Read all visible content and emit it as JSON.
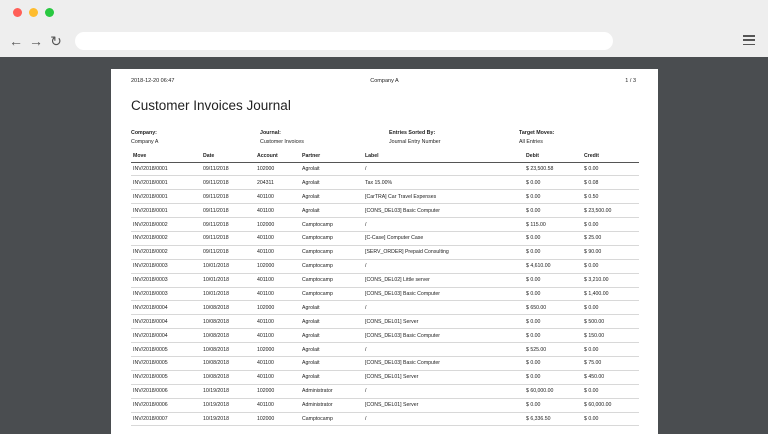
{
  "report": {
    "printed_at": "2018-12-20 06:47",
    "company_header": "Company A",
    "page": "1   /   3",
    "title": "Customer Invoices Journal",
    "info": [
      {
        "label": "Company:",
        "value": "Company A"
      },
      {
        "label": "Journal:",
        "value": "Customer Invoices"
      },
      {
        "label": "Entries Sorted By:",
        "value": "Journal Entry Number"
      },
      {
        "label": "Target Moves:",
        "value": "All Entries"
      }
    ],
    "columns": [
      "Move",
      "Date",
      "Account",
      "Partner",
      "Label",
      "Debit",
      "Credit"
    ],
    "rows": [
      [
        "INV/2018/0001",
        "09/11/2018",
        "102000",
        "Agrolait",
        "/",
        "$ 23,500.58",
        "$ 0.00"
      ],
      [
        "INV/2018/0001",
        "09/11/2018",
        "204311",
        "Agrolait",
        "Tax 15.00%",
        "$ 0.00",
        "$ 0.08"
      ],
      [
        "INV/2018/0001",
        "09/11/2018",
        "401100",
        "Agrolait",
        "[CarTRA] Car Travel Expenses",
        "$ 0.00",
        "$ 0.50"
      ],
      [
        "INV/2018/0001",
        "09/11/2018",
        "401100",
        "Agrolait",
        "[CONS_DEL03] Basic Computer",
        "$ 0.00",
        "$ 23,500.00"
      ],
      [
        "INV/2018/0002",
        "09/11/2018",
        "102000",
        "Camptocamp",
        "/",
        "$ 115.00",
        "$ 0.00"
      ],
      [
        "INV/2018/0002",
        "09/11/2018",
        "401100",
        "Camptocamp",
        "[C-Case] Computer Case",
        "$ 0.00",
        "$ 25.00"
      ],
      [
        "INV/2018/0002",
        "09/11/2018",
        "401100",
        "Camptocamp",
        "[SERV_ORDER] Prepaid Consulting",
        "$ 0.00",
        "$ 90.00"
      ],
      [
        "INV/2018/0003",
        "10/01/2018",
        "102000",
        "Camptocamp",
        "/",
        "$ 4,610.00",
        "$ 0.00"
      ],
      [
        "INV/2018/0003",
        "10/01/2018",
        "401100",
        "Camptocamp",
        "[CONS_DEL02] Little server",
        "$ 0.00",
        "$ 3,210.00"
      ],
      [
        "INV/2018/0003",
        "10/01/2018",
        "401100",
        "Camptocamp",
        "[CONS_DEL03] Basic Computer",
        "$ 0.00",
        "$ 1,400.00"
      ],
      [
        "INV/2018/0004",
        "10/08/2018",
        "102000",
        "Agrolait",
        "/",
        "$ 650.00",
        "$ 0.00"
      ],
      [
        "INV/2018/0004",
        "10/08/2018",
        "401100",
        "Agrolait",
        "[CONS_DEL01] Server",
        "$ 0.00",
        "$ 500.00"
      ],
      [
        "INV/2018/0004",
        "10/08/2018",
        "401100",
        "Agrolait",
        "[CONS_DEL03] Basic Computer",
        "$ 0.00",
        "$ 150.00"
      ],
      [
        "INV/2018/0005",
        "10/08/2018",
        "102000",
        "Agrolait",
        "/",
        "$ 525.00",
        "$ 0.00"
      ],
      [
        "INV/2018/0005",
        "10/08/2018",
        "401100",
        "Agrolait",
        "[CONS_DEL03] Basic Computer",
        "$ 0.00",
        "$ 75.00"
      ],
      [
        "INV/2018/0005",
        "10/08/2018",
        "401100",
        "Agrolait",
        "[CONS_DEL01] Server",
        "$ 0.00",
        "$ 450.00"
      ],
      [
        "INV/2018/0006",
        "10/19/2018",
        "102000",
        "Administrator",
        "/",
        "$ 60,000.00",
        "$ 0.00"
      ],
      [
        "INV/2018/0006",
        "10/19/2018",
        "401100",
        "Administrator",
        "[CONS_DEL01] Server",
        "$ 0.00",
        "$ 60,000.00"
      ],
      [
        "INV/2018/0007",
        "10/19/2018",
        "102000",
        "Camptocamp",
        "/",
        "$ 6,336.50",
        "$ 0.00"
      ]
    ]
  }
}
